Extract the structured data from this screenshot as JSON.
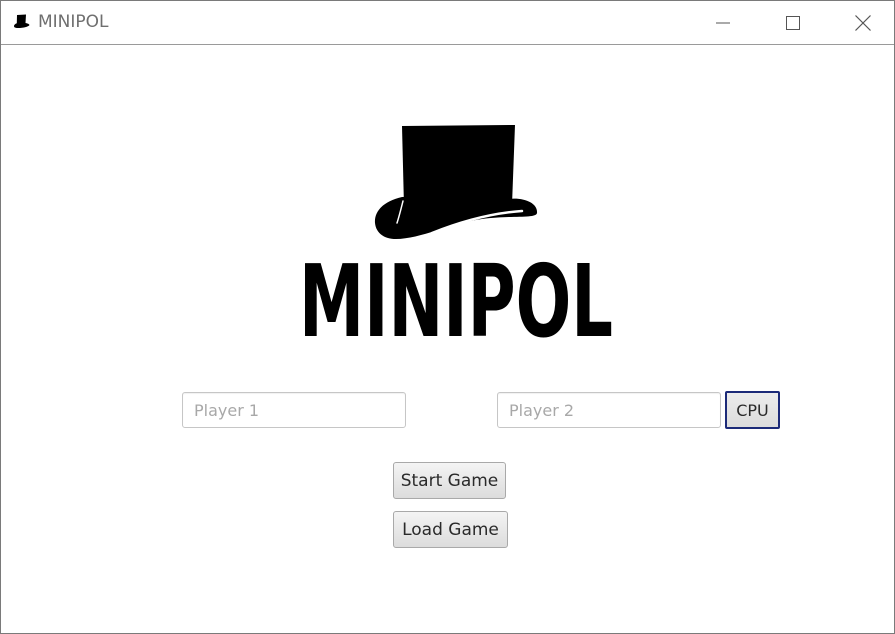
{
  "window": {
    "title": "MINIPOL",
    "app_icon": "top-hat-icon",
    "controls": {
      "minimize_icon": "minimize-icon",
      "maximize_icon": "maximize-icon",
      "close_icon": "close-icon"
    }
  },
  "logo": {
    "icon": "top-hat-icon",
    "wordmark": "MINIPOL"
  },
  "players": {
    "player1_placeholder": "Player 1",
    "player1_value": "",
    "player2_placeholder": "Player 2",
    "player2_value": "",
    "cpu_label": "CPU"
  },
  "actions": {
    "start_label": "Start Game",
    "load_label": "Load Game"
  },
  "colors": {
    "logo": "#000000",
    "cpu_focus_border": "#1c2a78",
    "placeholder": "#a8a8a8"
  }
}
